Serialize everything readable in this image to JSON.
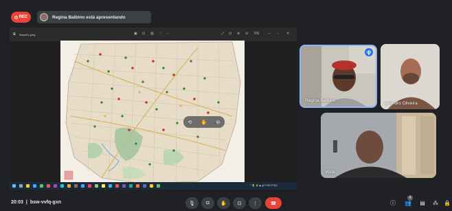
{
  "topbar": {
    "rec_label": "REC",
    "presenter_text": "Regina Balbino está apresentando"
  },
  "share": {
    "file_name": "Mapa01.jpeg",
    "viewer_icons": [
      "window-icon",
      "image-icon",
      "crop-icon",
      "heart-icon",
      "more-icon",
      "expand-icon",
      "fit-icon",
      "zoom-in-icon",
      "zoom-out-icon",
      "minimize-icon",
      "maximize-icon",
      "close-icon"
    ],
    "zoom_label": "6%",
    "pdf_toolbar": [
      "rotate-icon",
      "hand-icon",
      "zoom-out-icon"
    ],
    "tray_text": "^ 🔋 ⚡ ◆ 🔊 POR  PTB2"
  },
  "participants": {
    "regina": "Regina Balbino",
    "leandro": "Leandro Oliveira",
    "voce": "Você"
  },
  "bottombar": {
    "time": "20:03",
    "separator": "|",
    "meeting_code": "bsw-vvfq-gxn",
    "people_count": "4"
  },
  "colors": {
    "background": "#202124",
    "rec": "#ea4335",
    "accent": "#1a73e8",
    "tile_border": "#8ab4f8"
  }
}
